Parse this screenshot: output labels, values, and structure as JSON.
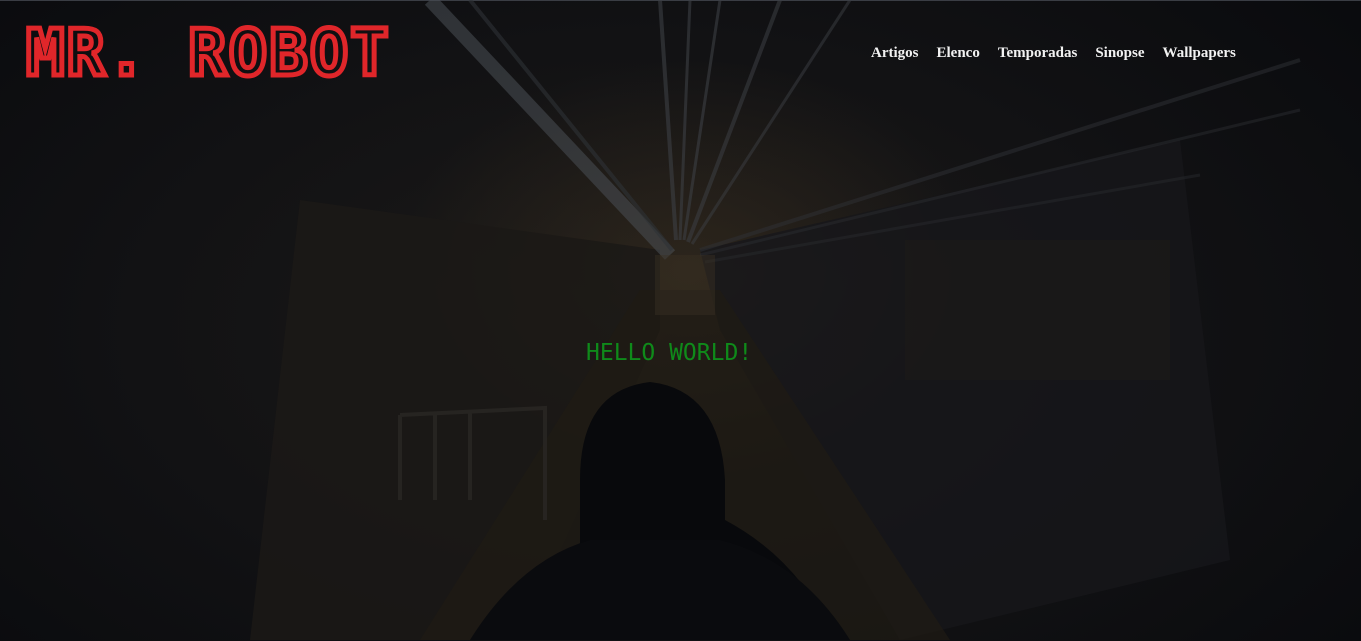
{
  "header": {
    "logo_text": "MR. ROBOT",
    "nav": [
      "Artigos",
      "Elenco",
      "Temporadas",
      "Sinopse",
      "Wallpapers"
    ]
  },
  "hero": {
    "headline": "HELLO WORLD!"
  },
  "colors": {
    "brand_red": "#e0262a",
    "nav_text": "#f2f2f2",
    "terminal_green": "#0f8a1a",
    "background": "#0b0c10"
  }
}
